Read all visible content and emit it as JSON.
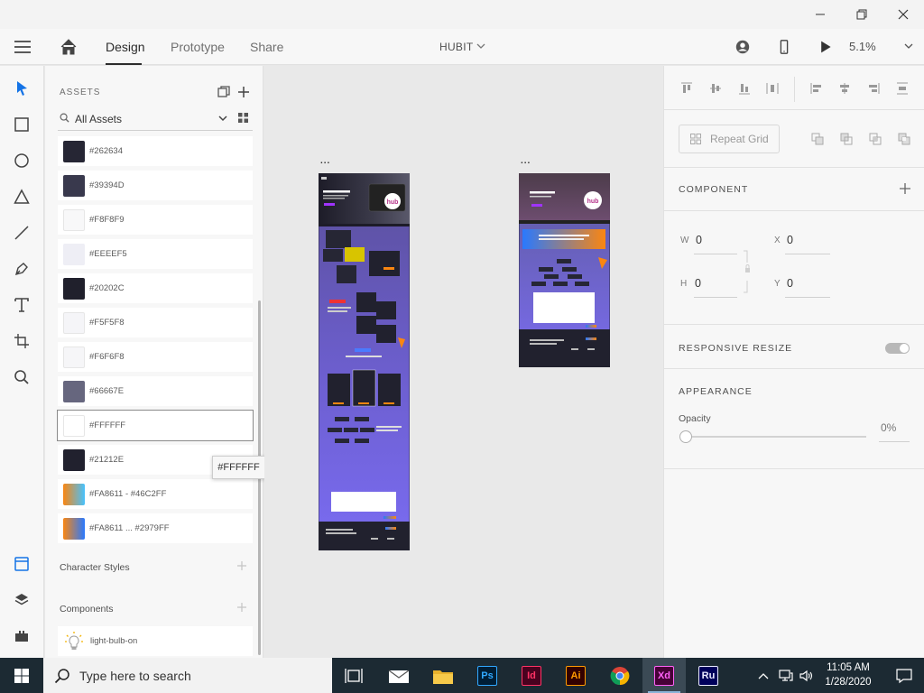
{
  "window": {
    "minimize": "minimize",
    "maximize": "restore",
    "close": "close"
  },
  "topbar": {
    "tabs": [
      {
        "label": "Design",
        "active": true
      },
      {
        "label": "Prototype",
        "active": false
      },
      {
        "label": "Share",
        "active": false
      }
    ],
    "document_title": "HUBIT",
    "zoom": "5.1%"
  },
  "toolbar": {
    "tools": [
      "select-tool",
      "rectangle-tool",
      "ellipse-tool",
      "polygon-tool",
      "line-tool",
      "pen-tool",
      "text-tool",
      "artboard-tool",
      "zoom-tool"
    ],
    "bottom": [
      "assets-panel",
      "layers-panel",
      "plugins-panel"
    ]
  },
  "assets": {
    "title": "ASSETS",
    "filter": "All Assets",
    "colors": [
      {
        "name": "#262634",
        "swatch": "#262634"
      },
      {
        "name": "#39394D",
        "swatch": "#39394D"
      },
      {
        "name": "#F8F8F9",
        "swatch": "#F8F8F9"
      },
      {
        "name": "#EEEEF5",
        "swatch": "#EEEEF5"
      },
      {
        "name": "#20202C",
        "swatch": "#20202C"
      },
      {
        "name": "#F5F5F8",
        "swatch": "#F5F5F8"
      },
      {
        "name": "#F6F6F8",
        "swatch": "#F6F6F8"
      },
      {
        "name": "#66667E",
        "swatch": "#66667E"
      },
      {
        "name": "#FFFFFF",
        "swatch": "#FFFFFF",
        "selected": true
      },
      {
        "name": "#21212E",
        "swatch": "#21212E"
      },
      {
        "name": "#FA8611 - #46C2FF",
        "gradient": [
          "#FA8611",
          "#46C2FF"
        ]
      },
      {
        "name": "#FA8611 ... #2979FF",
        "gradient": [
          "#FA8611",
          "#2979FF"
        ]
      }
    ],
    "character_styles_label": "Character Styles",
    "components_label": "Components",
    "components": [
      {
        "name": "light-bulb-on"
      }
    ],
    "tooltip": "#FFFFFF"
  },
  "canvas": {
    "artboards": [
      {
        "label": "..."
      },
      {
        "label": "..."
      }
    ]
  },
  "properties": {
    "repeat_grid": "Repeat Grid",
    "component_header": "COMPONENT",
    "w_label": "W",
    "w_value": "0",
    "h_label": "H",
    "h_value": "0",
    "x_label": "X",
    "x_value": "0",
    "y_label": "Y",
    "y_value": "0",
    "responsive_header": "RESPONSIVE RESIZE",
    "responsive_on": true,
    "appearance_header": "APPEARANCE",
    "opacity_label": "Opacity",
    "opacity_value": "0%"
  },
  "taskbar": {
    "search_placeholder": "Type here to search",
    "apps": [
      {
        "name": "task-view"
      },
      {
        "name": "mail"
      },
      {
        "name": "file-explorer"
      },
      {
        "name": "photoshop",
        "label": "Ps",
        "bg": "#001e36",
        "fg": "#31a8ff"
      },
      {
        "name": "indesign",
        "label": "Id",
        "bg": "#49021f",
        "fg": "#ff3366"
      },
      {
        "name": "illustrator",
        "label": "Ai",
        "bg": "#330000",
        "fg": "#ff9a00"
      },
      {
        "name": "chrome"
      },
      {
        "name": "xd",
        "label": "Xd",
        "bg": "#470137",
        "fg": "#ff61f6",
        "active": true
      },
      {
        "name": "rush",
        "label": "Ru",
        "bg": "#00005b",
        "fg": "#eaeaff"
      }
    ],
    "time": "11:05 AM",
    "date": "1/28/2020"
  }
}
